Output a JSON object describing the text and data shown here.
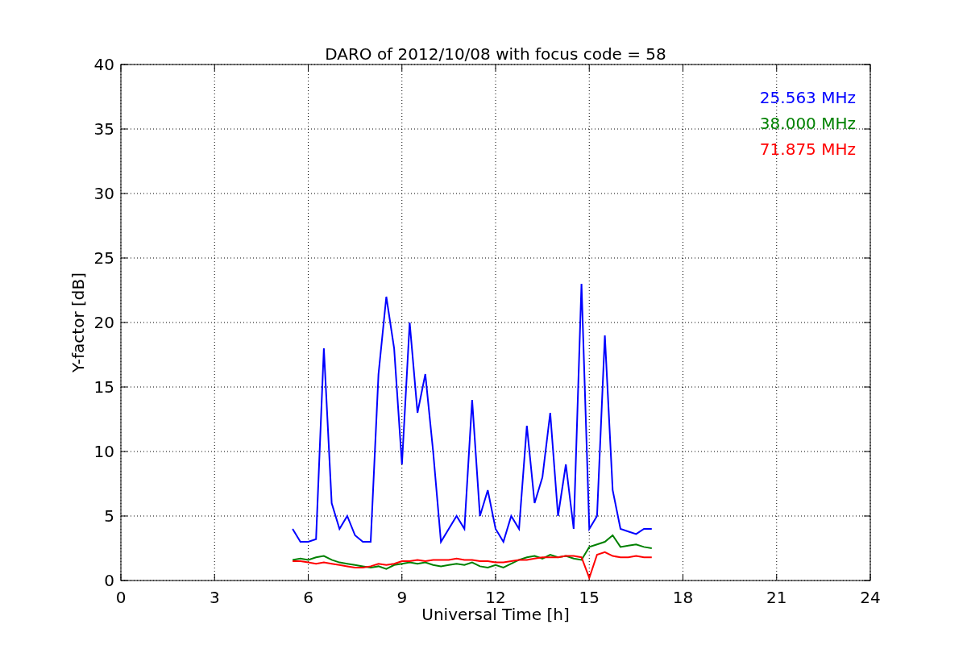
{
  "chart_data": {
    "type": "line",
    "title": "DARO of 2012/10/08 with focus code = 58",
    "xlabel": "Universal Time [h]",
    "ylabel": "Y-factor [dB]",
    "x": [
      5.5,
      5.75,
      6,
      6.25,
      6.5,
      6.75,
      7,
      7.25,
      7.5,
      7.75,
      8,
      8.25,
      8.5,
      8.75,
      9,
      9.25,
      9.5,
      9.75,
      10,
      10.25,
      10.5,
      10.75,
      11,
      11.25,
      11.5,
      11.75,
      12,
      12.25,
      12.5,
      12.75,
      13,
      13.25,
      13.5,
      13.75,
      14,
      14.25,
      14.5,
      14.75,
      15,
      15.25,
      15.5,
      15.75,
      16,
      16.25,
      16.5,
      16.75,
      17
    ],
    "series": [
      {
        "name": "25.563 MHz",
        "color": "#0000ff",
        "values": [
          4,
          3,
          3,
          3.2,
          18,
          6,
          4,
          5,
          3.5,
          3,
          3,
          16,
          22,
          18,
          9,
          20,
          13,
          16,
          10,
          3,
          4,
          5,
          4,
          14,
          5,
          7,
          4,
          3,
          5,
          4,
          12,
          6,
          8,
          13,
          5,
          9,
          4,
          23,
          4,
          5,
          19,
          7,
          4,
          3.8,
          3.6,
          4,
          4
        ]
      },
      {
        "name": "38.000 MHz",
        "color": "#008000",
        "values": [
          1.6,
          1.7,
          1.6,
          1.8,
          1.9,
          1.6,
          1.4,
          1.3,
          1.2,
          1.1,
          1.0,
          1.1,
          0.9,
          1.2,
          1.3,
          1.4,
          1.3,
          1.4,
          1.2,
          1.1,
          1.2,
          1.3,
          1.2,
          1.4,
          1.1,
          1.0,
          1.2,
          1.0,
          1.3,
          1.6,
          1.8,
          1.9,
          1.7,
          2.0,
          1.8,
          1.9,
          1.7,
          1.6,
          2.6,
          2.8,
          3.0,
          3.5,
          2.6,
          2.7,
          2.8,
          2.6,
          2.5
        ]
      },
      {
        "name": "71.875 MHz",
        "color": "#ff0000",
        "values": [
          1.5,
          1.5,
          1.4,
          1.3,
          1.4,
          1.3,
          1.2,
          1.1,
          1.0,
          1.0,
          1.1,
          1.3,
          1.2,
          1.3,
          1.5,
          1.5,
          1.6,
          1.5,
          1.6,
          1.6,
          1.6,
          1.7,
          1.6,
          1.6,
          1.5,
          1.5,
          1.4,
          1.4,
          1.5,
          1.6,
          1.6,
          1.7,
          1.8,
          1.8,
          1.8,
          1.9,
          1.9,
          1.8,
          0.2,
          2.0,
          2.2,
          1.9,
          1.8,
          1.8,
          1.9,
          1.8,
          1.8
        ]
      }
    ],
    "grid": true,
    "xlim": [
      0,
      24
    ],
    "ylim": [
      0,
      40
    ],
    "xticks": [
      0,
      3,
      6,
      9,
      12,
      15,
      18,
      21,
      24
    ],
    "yticks": [
      0,
      5,
      10,
      15,
      20,
      25,
      30,
      35,
      40
    ]
  }
}
